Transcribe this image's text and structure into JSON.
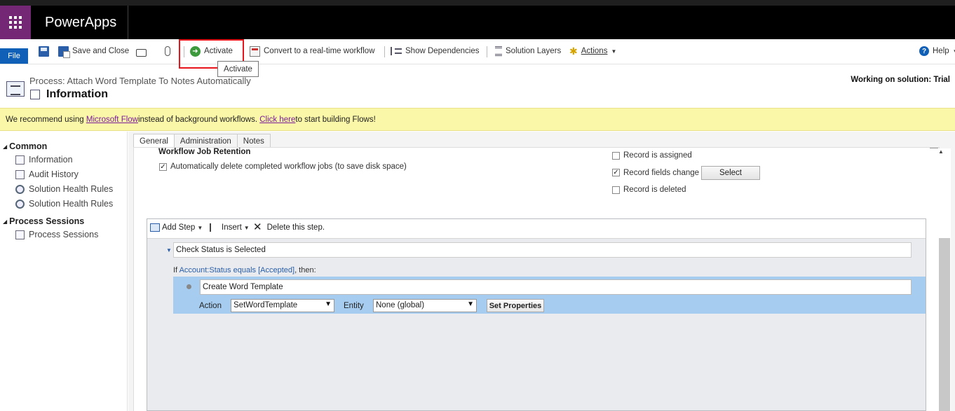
{
  "navbar": {
    "brand": "PowerApps",
    "waffle_icon": "waffle-icon"
  },
  "ribbon": {
    "file": "File",
    "save_and_close": "Save and Close",
    "activate": "Activate",
    "convert": "Convert to a real-time workflow",
    "show_dependencies": "Show Dependencies",
    "solution_layers": "Solution Layers",
    "actions": "Actions",
    "help": "Help"
  },
  "tooltip": "Activate",
  "header": {
    "process_title": "Process: Attach Word Template To Notes Automatically",
    "form_title": "Information",
    "working_on": "Working on solution: Trial"
  },
  "banner": {
    "prefix": "We recommend using ",
    "link1": "Microsoft Flow",
    "middle": " instead of background workflows. ",
    "link2": "Click here",
    "suffix": " to start building Flows!"
  },
  "leftnav": {
    "groups": [
      {
        "label": "Common",
        "items": [
          "Information",
          "Audit History",
          "Solution Health Rules",
          "Solution Health Rules"
        ]
      },
      {
        "label": "Process Sessions",
        "items": [
          "Process Sessions"
        ]
      }
    ]
  },
  "tabs": [
    "General",
    "Administration",
    "Notes"
  ],
  "general": {
    "retention_heading": "Workflow Job Retention",
    "auto_delete_label": "Automatically delete completed workflow jobs (to save disk space)",
    "auto_delete_checked": true,
    "triggers": [
      {
        "label": "Record is assigned",
        "checked": false
      },
      {
        "label": "Record fields change",
        "checked": true
      },
      {
        "label": "Record is deleted",
        "checked": false
      }
    ],
    "select_button": "Select"
  },
  "designer": {
    "add_step": "Add Step",
    "insert": "Insert",
    "delete_step": "Delete this step.",
    "step_name": "Check Status is Selected",
    "cond_if": "If ",
    "cond_expr": "Account:Status equals [Accepted]",
    "cond_then": ", then:",
    "action_name": "Create Word Template",
    "action_label": "Action",
    "action_value": "SetWordTemplate",
    "entity_label": "Entity",
    "entity_value": "None (global)",
    "set_properties": "Set Properties"
  }
}
